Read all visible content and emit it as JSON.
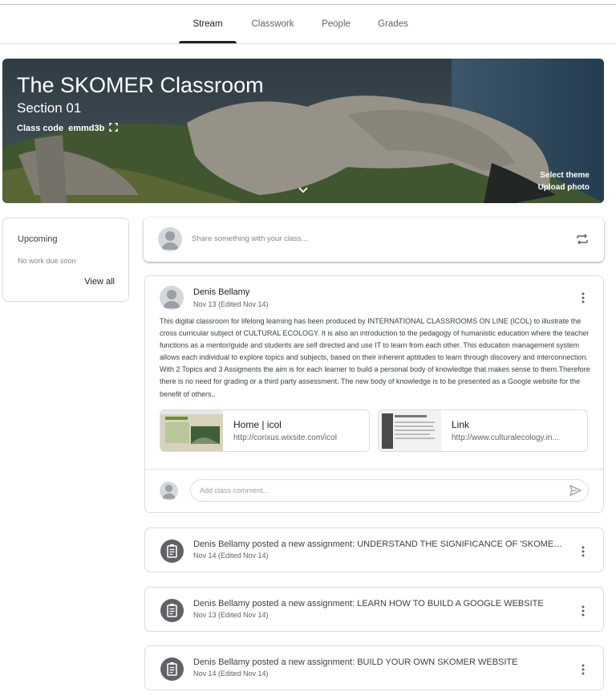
{
  "tabs": [
    {
      "label": "Stream"
    },
    {
      "label": "Classwork"
    },
    {
      "label": "People"
    },
    {
      "label": "Grades"
    }
  ],
  "banner": {
    "title": "The SKOMER Classroom",
    "section": "Section 01",
    "class_code_label": "Class code",
    "class_code": "emmd3b",
    "select_theme": "Select theme",
    "upload_photo": "Upload photo"
  },
  "upcoming": {
    "title": "Upcoming",
    "empty": "No work due soon",
    "view_all": "View all"
  },
  "share": {
    "placeholder": "Share something with your class..."
  },
  "post": {
    "author": "Denis Bellamy",
    "date": "Nov 13 (Edited Nov 14)",
    "body": "This digital classroom for lifelong learning has been produced by INTERNATIONAL CLASSROOMS ON LINE (ICOL) to illustrate the cross curricular subject of CULTURAL ECOLOGY. It is also an introduction to the pedagogy of humanistic education where the teacher functions as a mentor/guide and students are self directed and use IT to learn from each other. This education management system allows each individual to explore topics and subjects, based on their inherent aptitudes to learn through discovery and interconnection. With 2 Topics and 3 Assigments the aim is for each learner to build a personal body of knowledtge that makes sense to them.Therefore there is no need for grading or a third party assessment. The new body of knowledge is to be presented as a Google website for the benefit of others..",
    "attachments": [
      {
        "title": "Home | icol",
        "url": "http://corixus.wixsite.com/icol"
      },
      {
        "title": "Link",
        "url": "http://www.culturalecology.in..."
      }
    ],
    "comment_placeholder": "Add class comment..."
  },
  "assignments": [
    {
      "title": "Denis Bellamy posted a new assignment: UNDERSTAND THE SIGNIFICANCE OF 'SKOMER' T...",
      "date": "Nov 14 (Edited Nov 14)"
    },
    {
      "title": "Denis Bellamy posted a new assignment: LEARN HOW TO BUILD A GOOGLE WEBSITE",
      "date": "Nov 13 (Edited Nov 14)"
    },
    {
      "title": "Denis Bellamy posted a new assignment: BUILD YOUR OWN SKOMER WEBSITE",
      "date": "Nov 14 (Edited Nov 14)"
    }
  ],
  "colors": {
    "banner_sky": "#2c3e50",
    "banner_grass": "#4e6b3a",
    "rock": "#b9b4a6",
    "assignment_icon": "#5f6368"
  },
  "icons": [
    "fullscreen-icon",
    "chevron-down-icon",
    "repost-icon",
    "more-vert-icon",
    "send-icon",
    "assignment-icon"
  ]
}
